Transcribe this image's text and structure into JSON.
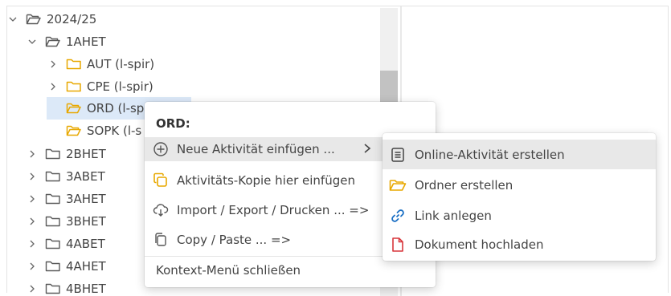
{
  "tree": {
    "items": [
      {
        "label": "2024/25",
        "expanded": true
      },
      {
        "label": "1AHET",
        "expanded": true
      },
      {
        "label": "AUT (l-spir)",
        "expanded": false,
        "color": "yellow"
      },
      {
        "label": "CPE (l-spir)",
        "expanded": false,
        "color": "yellow"
      },
      {
        "label": "ORD (l-sp",
        "selected": true,
        "color": "yellow"
      },
      {
        "label": "SOPK (l-s",
        "color": "yellow"
      },
      {
        "label": "2BHET",
        "expanded": false
      },
      {
        "label": "3ABET",
        "expanded": false
      },
      {
        "label": "3AHET",
        "expanded": false
      },
      {
        "label": "3BHET",
        "expanded": false
      },
      {
        "label": "4ABET",
        "expanded": false
      },
      {
        "label": "4AHET",
        "expanded": false
      },
      {
        "label": "4BHET",
        "expanded": false
      }
    ]
  },
  "context_menu": {
    "title": "ORD:",
    "items": [
      {
        "label": "Neue Aktivität einfügen ...",
        "icon": "plus-circle-icon",
        "has_submenu": true,
        "highlighted": true
      },
      {
        "label": "Aktivitäts-Kopie hier einfügen",
        "icon": "copy-paste-icon"
      },
      {
        "label": "Import / Export / Drucken ... =>",
        "icon": "cloud-transfer-icon"
      },
      {
        "label": "Copy / Paste ... =>",
        "icon": "clipboard-icon"
      }
    ],
    "close_label": "Kontext-Menü schließen"
  },
  "submenu": {
    "items": [
      {
        "label": "Online-Aktivität erstellen",
        "icon": "document-list-icon",
        "highlighted": true
      },
      {
        "label": "Ordner erstellen",
        "icon": "folder-icon"
      },
      {
        "label": "Link anlegen",
        "icon": "link-icon"
      },
      {
        "label": "Dokument hochladen",
        "icon": "file-upload-icon"
      }
    ]
  },
  "colors": {
    "folder_outline": "#5a5a5a",
    "folder_yellow": "#e8a800",
    "selection": "#dce9f8",
    "menu_highlight": "#e8e8e8",
    "link_blue": "#1a6fc4",
    "document_red": "#d8373c"
  }
}
